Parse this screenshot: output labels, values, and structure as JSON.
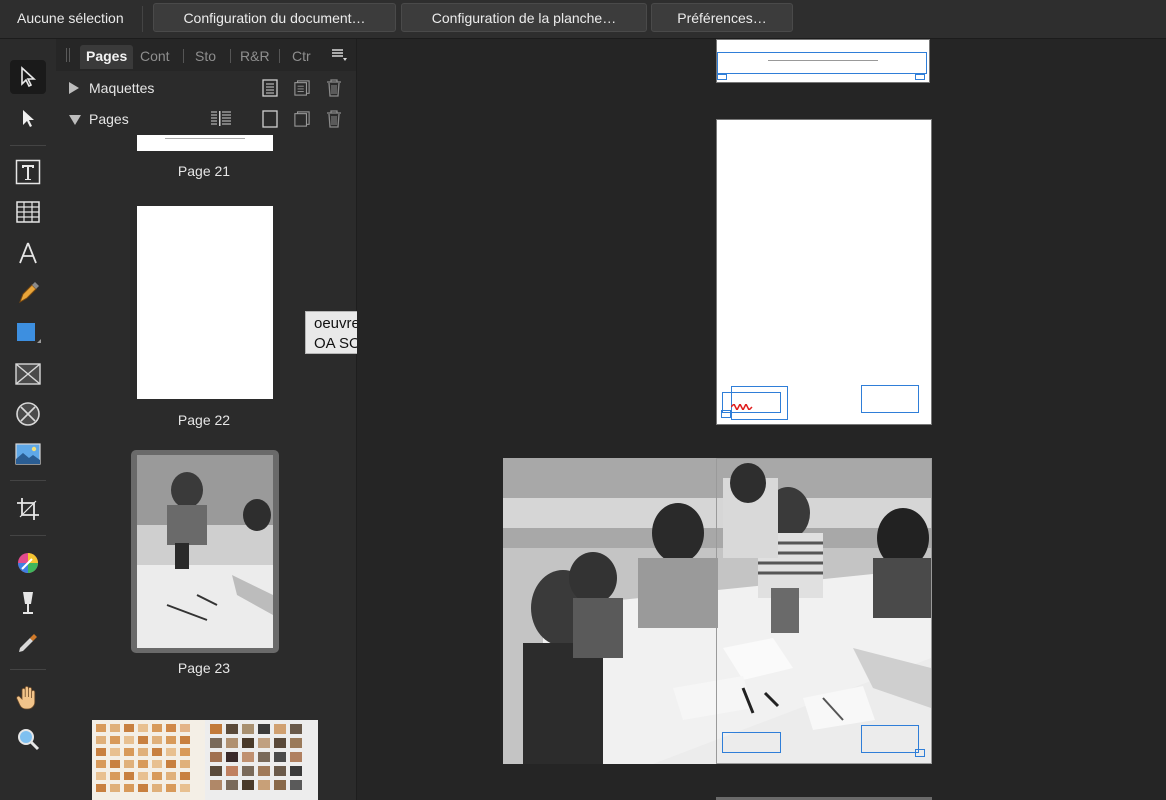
{
  "context_bar": {
    "selection_label": "Aucune sélection",
    "buttons": [
      {
        "label": "Configuration du document…"
      },
      {
        "label": "Configuration de la planche…"
      },
      {
        "label": "Préférences…"
      }
    ]
  },
  "tools": [
    {
      "icon": "move-tool-icon",
      "active": true
    },
    {
      "icon": "node-tool-icon"
    },
    {
      "icon": "text-frame-tool-icon"
    },
    {
      "icon": "table-tool-icon"
    },
    {
      "icon": "artistic-text-tool-icon"
    },
    {
      "icon": "pen-tool-icon"
    },
    {
      "icon": "rectangle-tool-icon"
    },
    {
      "icon": "picture-frame-rect-icon"
    },
    {
      "icon": "picture-frame-ellipse-icon"
    },
    {
      "icon": "place-image-tool-icon"
    },
    {
      "icon": "crop-tool-icon"
    },
    {
      "icon": "color-picker-icon"
    },
    {
      "icon": "fill-tool-icon"
    },
    {
      "icon": "eyedropper-icon"
    },
    {
      "icon": "hand-tool-icon"
    },
    {
      "icon": "zoom-tool-icon"
    }
  ],
  "panel": {
    "tabs": [
      "Pages",
      "Cont",
      "Sto",
      "R&R",
      "Ctr"
    ],
    "active_tab": "Pages",
    "sections": {
      "masters": "Maquettes",
      "pages": "Pages"
    },
    "pages": [
      {
        "caption": "Page 21"
      },
      {
        "caption": "Page 22"
      },
      {
        "caption": "Page 23",
        "selected": true
      }
    ]
  },
  "tooltip": {
    "line1": "oeuvres",
    "line2": "OA SOMBRE G"
  },
  "colors": {
    "frame_blue": "#2f7ed8",
    "accent_red": "#e02020"
  }
}
